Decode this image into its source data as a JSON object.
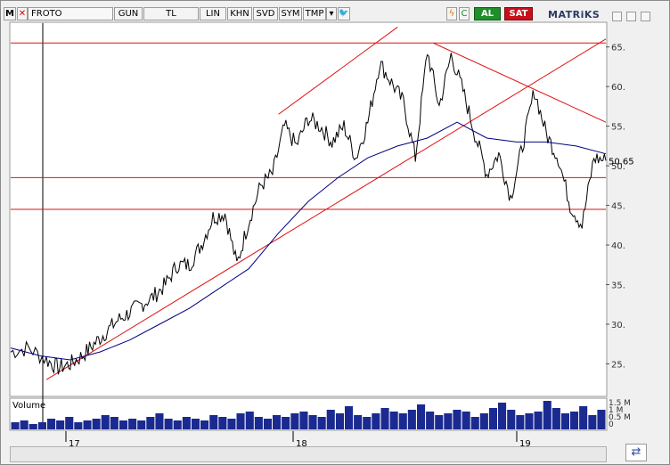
{
  "toolbar": {
    "m_label": "M",
    "symbol": "FROTO",
    "period": "GUN",
    "currency": "TL",
    "scale": "LIN",
    "khn": "KHN",
    "svd": "SVD",
    "sym": "SYM",
    "tmp": "TMP",
    "buy": "AL",
    "sell": "SAT",
    "logo": "MATRiKS"
  },
  "colors": {
    "price": "#000000",
    "moving_average": "#000080",
    "trendline": "#e01010",
    "buy_bg": "#1f8f2a",
    "sell_bg": "#c8101a"
  },
  "chart_data": {
    "type": "line",
    "x_ticks": [
      "17",
      "18",
      "19"
    ],
    "ylim": [
      21,
      68
    ],
    "yticks": [
      25,
      30,
      35,
      40,
      45,
      50,
      55,
      60,
      65
    ],
    "last_value": "50.65",
    "volume_label": "Volume",
    "volume_ticks": [
      "1.5 M",
      "1 M",
      "0.5 M",
      "0"
    ],
    "series": [
      {
        "kind": "price",
        "x": [
          0,
          3,
          6,
          8,
          10,
          12,
          14,
          16,
          18,
          20,
          22,
          24,
          26,
          28,
          30,
          32,
          34,
          36,
          38,
          40,
          42,
          44,
          46,
          48,
          50,
          52,
          54,
          56,
          58,
          60,
          62,
          64,
          66,
          68,
          70,
          72,
          74,
          76,
          78,
          80,
          82,
          84,
          86,
          88,
          90,
          92,
          94,
          96,
          98,
          100
        ],
        "y": [
          26.5,
          27.0,
          25.5,
          24.5,
          25.0,
          26.0,
          27.5,
          29.0,
          30.5,
          31.5,
          32.5,
          33.5,
          35.0,
          37.5,
          37.5,
          40.0,
          43.5,
          44.0,
          37.5,
          43.0,
          47.5,
          49.0,
          55.0,
          52.5,
          56.0,
          55.0,
          53.0,
          55.0,
          51.0,
          55.5,
          63.0,
          60.5,
          58.0,
          51.0,
          64.5,
          57.5,
          64.0,
          59.5,
          54.0,
          49.0,
          51.5,
          46.0,
          52.5,
          59.5,
          54.0,
          51.0,
          45.0,
          42.5,
          51.0,
          50.65
        ]
      },
      {
        "kind": "moving_average",
        "x": [
          0,
          5,
          10,
          15,
          20,
          25,
          30,
          35,
          40,
          45,
          50,
          55,
          60,
          65,
          70,
          75,
          80,
          85,
          90,
          95,
          100
        ],
        "y": [
          27.0,
          26.0,
          25.5,
          26.5,
          28.0,
          30.0,
          32.0,
          34.5,
          37.0,
          41.5,
          45.5,
          48.5,
          51.0,
          52.5,
          53.5,
          55.5,
          53.5,
          53.0,
          53.0,
          52.5,
          51.5
        ]
      }
    ],
    "trendlines": [
      {
        "y": 65.5
      },
      {
        "y": 48.5
      },
      {
        "y": 44.5
      }
    ],
    "diagonals": [
      {
        "x1": 6,
        "y1": 23,
        "x2": 100,
        "y2": 66
      },
      {
        "x1": 45,
        "y1": 56.5,
        "x2": 65,
        "y2": 67.5
      },
      {
        "x1": 71,
        "y1": 65.5,
        "x2": 100,
        "y2": 55.5
      }
    ],
    "volume": [
      0.4,
      0.5,
      0.3,
      0.4,
      0.6,
      0.5,
      0.7,
      0.4,
      0.5,
      0.6,
      0.8,
      0.7,
      0.5,
      0.6,
      0.5,
      0.7,
      0.9,
      0.6,
      0.5,
      0.7,
      0.6,
      0.5,
      0.8,
      0.7,
      0.6,
      0.9,
      1.0,
      0.7,
      0.6,
      0.8,
      0.7,
      0.9,
      1.0,
      0.8,
      0.7,
      1.1,
      0.9,
      1.3,
      0.8,
      0.7,
      0.9,
      1.2,
      1.0,
      0.9,
      1.1,
      1.4,
      1.0,
      0.8,
      0.9,
      1.1,
      1.0,
      0.7,
      0.9,
      1.2,
      1.5,
      1.1,
      0.8,
      0.9,
      1.0,
      1.6,
      1.2,
      0.9,
      1.0,
      1.3,
      0.8,
      1.1
    ]
  }
}
